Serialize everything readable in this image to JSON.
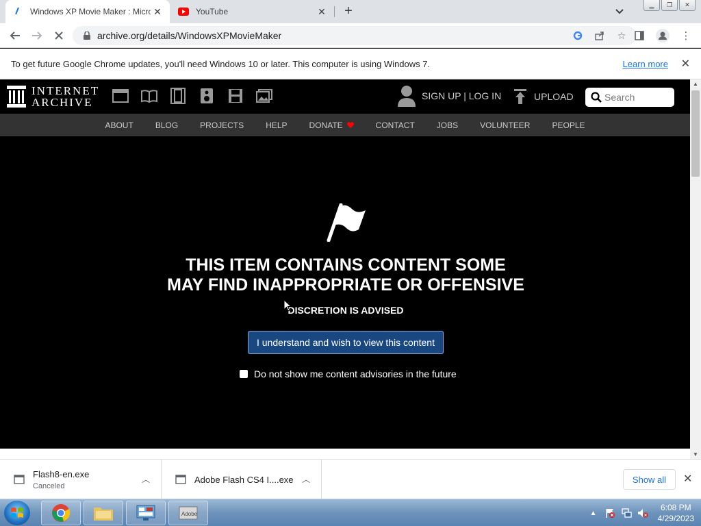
{
  "browser": {
    "tabs": [
      {
        "title": "Windows XP Movie Maker : Micro",
        "favicon": "archive-favicon",
        "active": true
      },
      {
        "title": "YouTube",
        "favicon": "youtube-favicon",
        "active": false
      }
    ],
    "url": "archive.org/details/WindowsXPMovieMaker",
    "infobar": {
      "message": "To get future Google Chrome updates, you'll need Windows 10 or later. This computer is using Windows 7.",
      "link": "Learn more"
    }
  },
  "ia_header": {
    "logo_line1": "INTERNET",
    "logo_line2": "ARCHIVE",
    "user_links": "SIGN UP | LOG IN",
    "upload_label": "UPLOAD",
    "search_placeholder": "Search",
    "nav": [
      "ABOUT",
      "BLOG",
      "PROJECTS",
      "HELP",
      "DONATE",
      "CONTACT",
      "JOBS",
      "VOLUNTEER",
      "PEOPLE"
    ]
  },
  "advisory": {
    "headline_line1": "THIS ITEM CONTAINS CONTENT SOME",
    "headline_line2": "MAY FIND INAPPROPRIATE OR OFFENSIVE",
    "subtext": "DISCRETION IS ADVISED",
    "button_label": "I understand and wish to view this content",
    "checkbox_label": "Do not show me content advisories in the future"
  },
  "downloads": {
    "items": [
      {
        "name": "Flash8-en.exe",
        "status": "Canceled"
      },
      {
        "name": "Adobe Flash CS4 I....exe",
        "status": ""
      }
    ],
    "show_all": "Show all"
  },
  "taskbar": {
    "time": "6:08 PM",
    "date": "4/29/2023"
  },
  "colors": {
    "ia_black": "#000000",
    "ia_nav": "#333333",
    "button_blue": "#194880",
    "chrome_link": "#1a73e8",
    "youtube_red": "#ff0000"
  }
}
